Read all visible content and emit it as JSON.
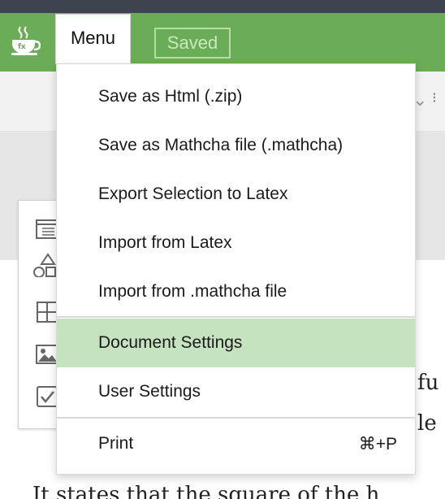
{
  "header": {
    "menu_label": "Menu",
    "saved_label": "Saved",
    "logo_icon": "coffee-cup-logo-icon",
    "colors": {
      "app_bar": "#6aad56",
      "top_strip": "#3c4450",
      "highlight": "#c5e3be"
    }
  },
  "menu": {
    "items": [
      {
        "label": "Save as Html (.zip)"
      },
      {
        "label": "Save as Mathcha file (.mathcha)"
      },
      {
        "label": "Export Selection to Latex"
      },
      {
        "label": "Import from Latex"
      },
      {
        "label": "Import from .mathcha file"
      },
      {
        "label": "Document Settings",
        "highlighted": true
      },
      {
        "label": "User Settings"
      },
      {
        "label": "Print",
        "shortcut": "⌘+P"
      }
    ]
  },
  "side_panel": {
    "icons": [
      "text-block-icon",
      "shapes-icon",
      "table-icon",
      "image-icon",
      "checkbox-icon"
    ]
  },
  "document": {
    "line1_fragment": "fu",
    "line2_fragment": "le",
    "line3_fragment": "It states that the square of the h"
  }
}
